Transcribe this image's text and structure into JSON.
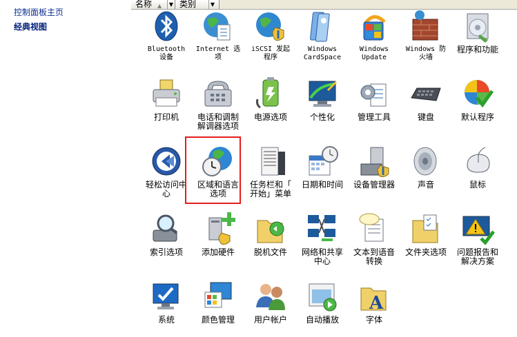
{
  "sidebar": {
    "home_link": "控制面板主页",
    "classic_view": "经典视图"
  },
  "columns": {
    "name": "名称",
    "category": "类别"
  },
  "items": [
    {
      "label": "Bluetooth\n设备",
      "icon": "bluetooth-icon"
    },
    {
      "label": "Internet 选\n项",
      "icon": "internet-options-icon"
    },
    {
      "label": "iSCSI 发起\n程序",
      "icon": "iscsi-initiator-icon"
    },
    {
      "label": "Windows\nCardSpace",
      "icon": "cardspace-icon"
    },
    {
      "label": "Windows\nUpdate",
      "icon": "windows-update-icon"
    },
    {
      "label": "Windows 防\n火墙",
      "icon": "firewall-icon"
    },
    {
      "label": "程序和功能",
      "icon": "programs-features-icon"
    },
    {
      "label": "打印机",
      "icon": "printer-icon"
    },
    {
      "label": "电话和调制\n解调器选项",
      "icon": "phone-modem-icon"
    },
    {
      "label": "电源选项",
      "icon": "power-options-icon"
    },
    {
      "label": "个性化",
      "icon": "personalization-icon"
    },
    {
      "label": "管理工具",
      "icon": "admin-tools-icon"
    },
    {
      "label": "键盘",
      "icon": "keyboard-icon"
    },
    {
      "label": "默认程序",
      "icon": "default-programs-icon"
    },
    {
      "label": "轻松访问中\n心",
      "icon": "ease-of-access-icon"
    },
    {
      "label": "区域和语言\n选项",
      "icon": "region-language-icon"
    },
    {
      "label": "任务栏和「\n开始」菜单",
      "icon": "taskbar-start-icon"
    },
    {
      "label": "日期和时间",
      "icon": "date-time-icon"
    },
    {
      "label": "设备管理器",
      "icon": "device-manager-icon"
    },
    {
      "label": "声音",
      "icon": "sound-icon"
    },
    {
      "label": "鼠标",
      "icon": "mouse-icon"
    },
    {
      "label": "索引选项",
      "icon": "indexing-icon"
    },
    {
      "label": "添加硬件",
      "icon": "add-hardware-icon"
    },
    {
      "label": "脱机文件",
      "icon": "offline-files-icon"
    },
    {
      "label": "网络和共享\n中心",
      "icon": "network-sharing-icon"
    },
    {
      "label": "文本到语音\n转换",
      "icon": "text-to-speech-icon"
    },
    {
      "label": "文件夹选项",
      "icon": "folder-options-icon"
    },
    {
      "label": "问题报告和\n解决方案",
      "icon": "problem-reports-icon"
    },
    {
      "label": "系统",
      "icon": "system-icon"
    },
    {
      "label": "颜色管理",
      "icon": "color-management-icon"
    },
    {
      "label": "用户帐户",
      "icon": "user-accounts-icon"
    },
    {
      "label": "自动播放",
      "icon": "autoplay-icon"
    },
    {
      "label": "字体",
      "icon": "fonts-icon"
    }
  ],
  "selected_item": "区域和语言\n选项",
  "colors": {
    "selection_border": "#e31b1b",
    "link": "#0b2e8f"
  }
}
